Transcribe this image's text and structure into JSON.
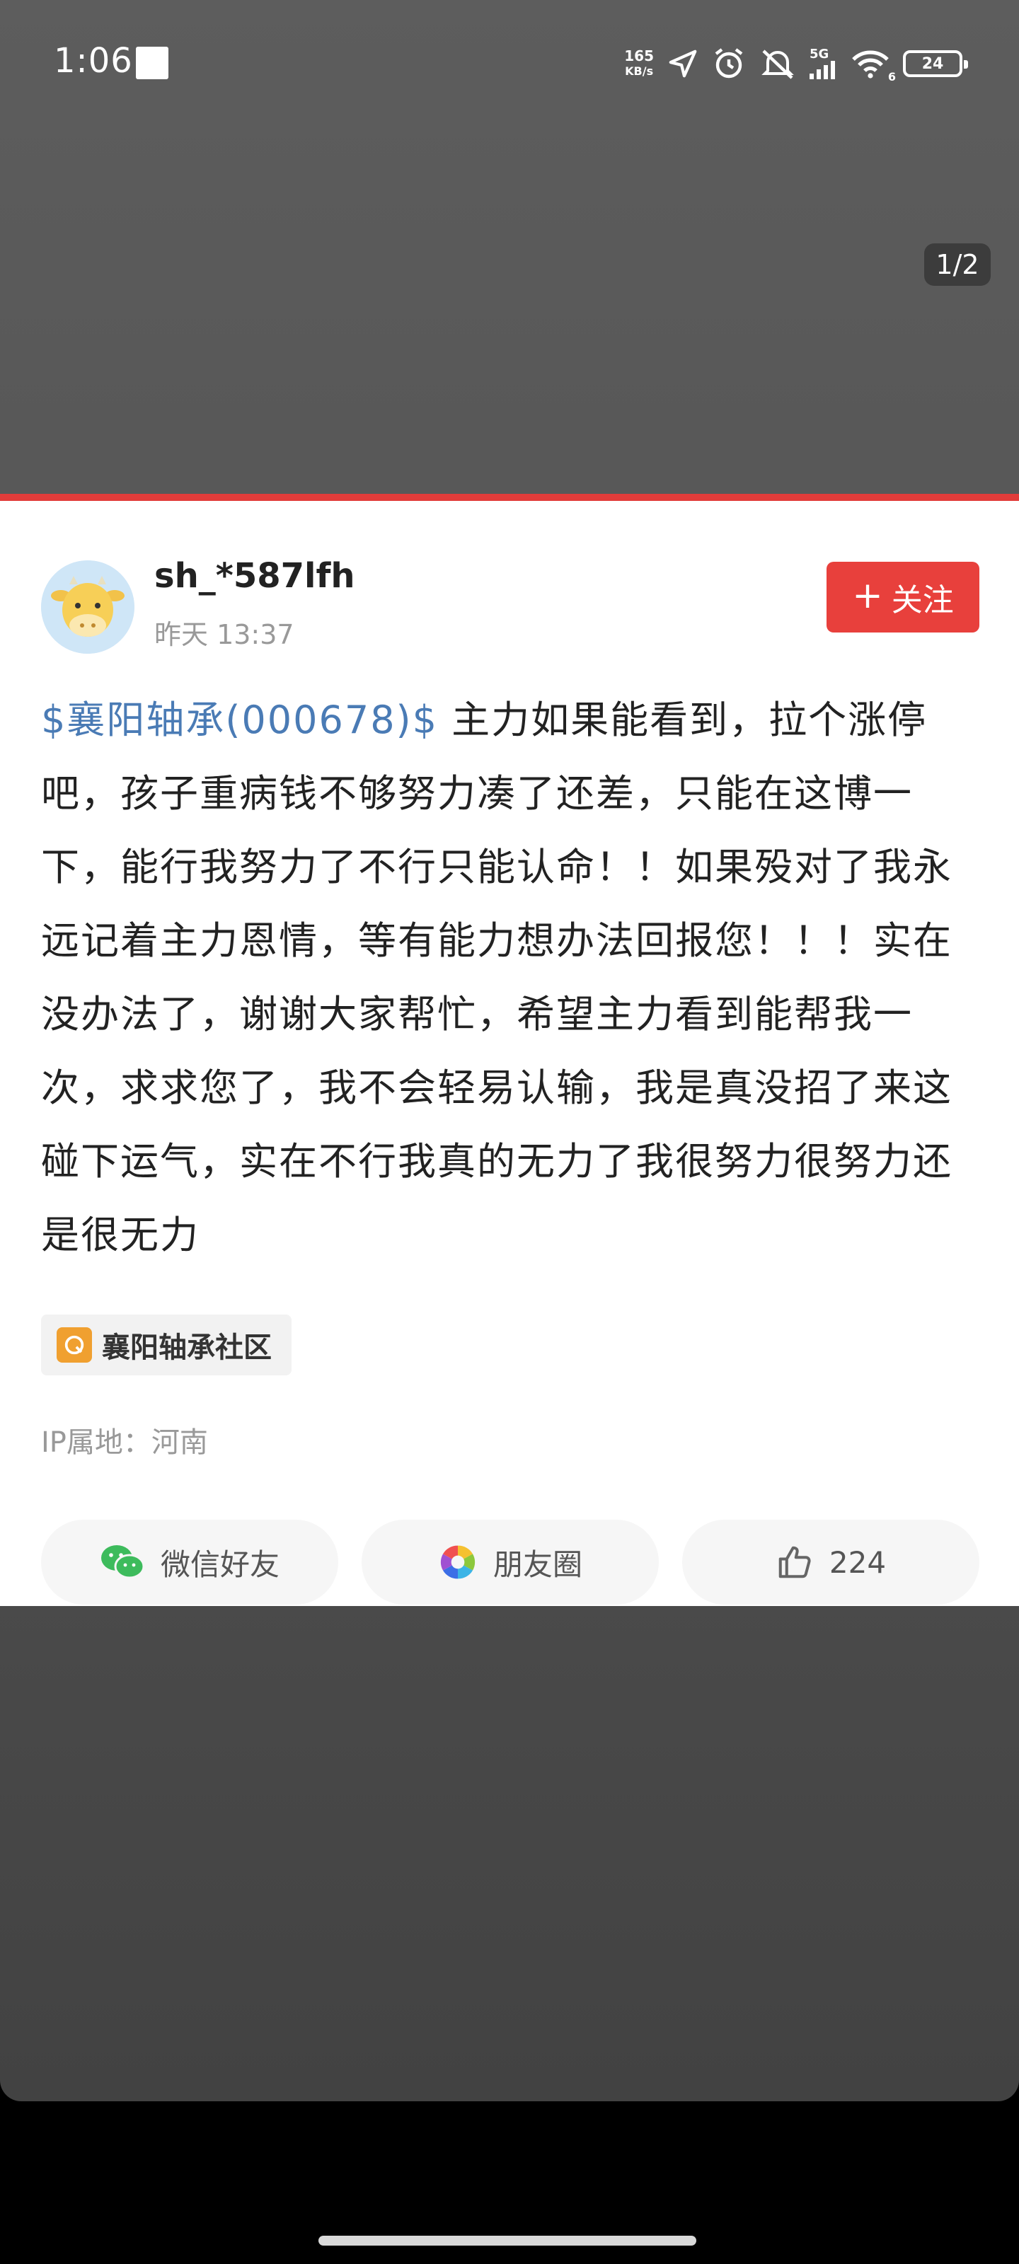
{
  "status_bar": {
    "time": "1:06",
    "net_speed_value": "165",
    "net_speed_unit": "KB/s",
    "signal_label": "5G",
    "wifi_label": "6",
    "battery": "24"
  },
  "viewer": {
    "page_counter": "1/2"
  },
  "post": {
    "username": "sh_*587lfh",
    "time": "昨天 13:37",
    "follow_label": "关注",
    "follow_plus": "+",
    "stock_link": "$襄阳轴承(000678)$",
    "body": " 主力如果能看到，拉个涨停吧，孩子重病钱不够努力凑了还差，只能在这博一下，能行我努力了不行只能认命！！如果殁对了我永远记着主力恩情，等有能力想办法回报您！！！实在没办法了，谢谢大家帮忙，希望主力看到能帮我一次，求求您了，我不会轻易认输，我是真没招了来这碰下运气，实在不行我真的无力了我很努力很努力还是很无力",
    "community_tag": "襄阳轴承社区",
    "ip_location": "IP属地：河南"
  },
  "share": {
    "wechat_label": "微信好友",
    "moments_label": "朋友圈",
    "like_count": "224"
  },
  "colors": {
    "accent_red": "#e8403c",
    "link_blue": "#4a7bb5",
    "tag_orange": "#f0a030"
  }
}
